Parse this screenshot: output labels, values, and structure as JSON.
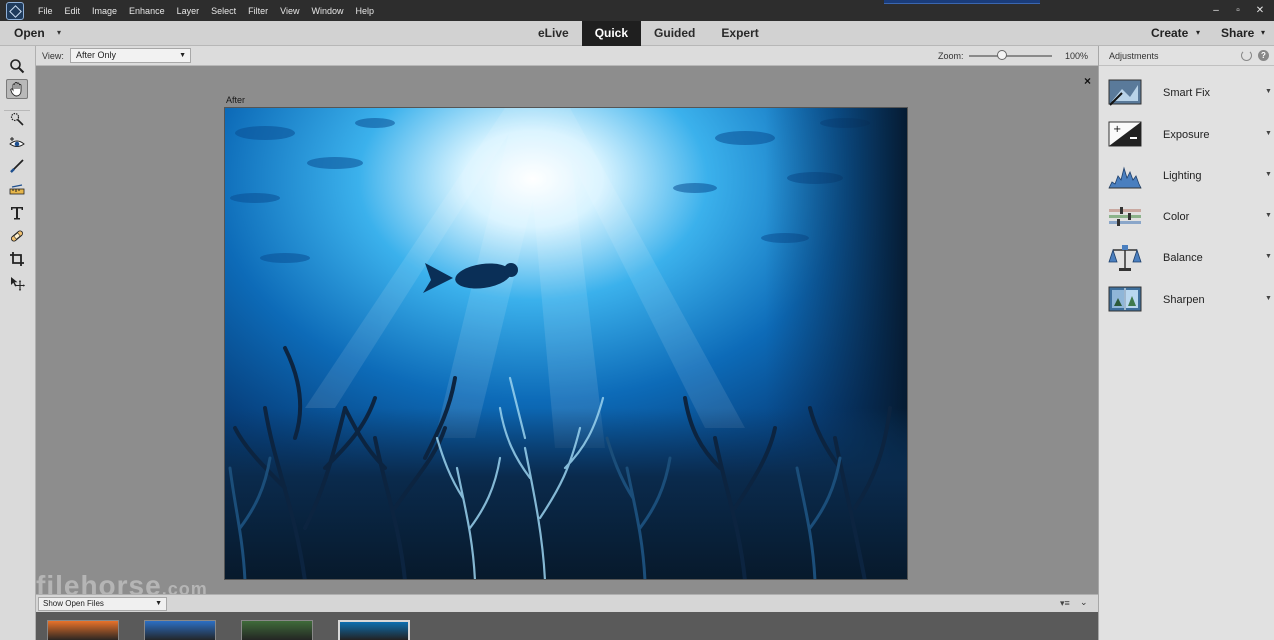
{
  "menubar": {
    "items": [
      "File",
      "Edit",
      "Image",
      "Enhance",
      "Layer",
      "Select",
      "Filter",
      "View",
      "Window",
      "Help"
    ],
    "win_controls": [
      "–",
      "▫",
      "✕"
    ]
  },
  "modebar": {
    "open_label": "Open",
    "tabs": [
      "eLive",
      "Quick",
      "Guided",
      "Expert"
    ],
    "active_tab": "Quick",
    "create_label": "Create",
    "share_label": "Share",
    "caret": "▾"
  },
  "options": {
    "view_label": "View:",
    "view_value": "After Only",
    "zoom_label": "Zoom:",
    "zoom_value": "100%",
    "zoom_level": 0.4
  },
  "tools": [
    {
      "name": "zoom-tool",
      "icon": "magnifier-icon"
    },
    {
      "name": "hand-tool",
      "icon": "hand-icon",
      "active": true
    },
    {
      "name": "quick-selection-tool",
      "icon": "quick-select-icon"
    },
    {
      "name": "red-eye-tool",
      "icon": "eye-icon"
    },
    {
      "name": "whiten-teeth-tool",
      "icon": "brush-icon"
    },
    {
      "name": "straighten-tool",
      "icon": "ruler-icon"
    },
    {
      "name": "type-tool",
      "icon": "type-icon"
    },
    {
      "name": "spot-healing-tool",
      "icon": "bandage-icon"
    },
    {
      "name": "crop-tool",
      "icon": "crop-icon"
    },
    {
      "name": "move-tool",
      "icon": "move-icon"
    }
  ],
  "canvas": {
    "after_label": "After",
    "close_symbol": "×"
  },
  "watermark": {
    "text": "filehorse",
    "suffix": ".com"
  },
  "bin": {
    "select_value": "Show Open Files",
    "menu_symbol": "▾≡",
    "collapse_symbol": "⌄",
    "thumb_colors": [
      "#e8722a",
      "#2c6fc4",
      "#3f6b3a",
      "#0c6fb0"
    ]
  },
  "adjustments": {
    "title": "Adjustments",
    "help_symbol": "?",
    "items": [
      {
        "label": "Smart Fix",
        "icon": "smart-fix-icon"
      },
      {
        "label": "Exposure",
        "icon": "exposure-icon"
      },
      {
        "label": "Lighting",
        "icon": "lighting-icon"
      },
      {
        "label": "Color",
        "icon": "color-icon"
      },
      {
        "label": "Balance",
        "icon": "balance-icon"
      },
      {
        "label": "Sharpen",
        "icon": "sharpen-icon"
      }
    ]
  },
  "colors": {
    "accent": "#1f1f1f",
    "water_deep": "#062a55",
    "water_mid": "#0f6fbf",
    "light_ray": "#ffffff"
  }
}
